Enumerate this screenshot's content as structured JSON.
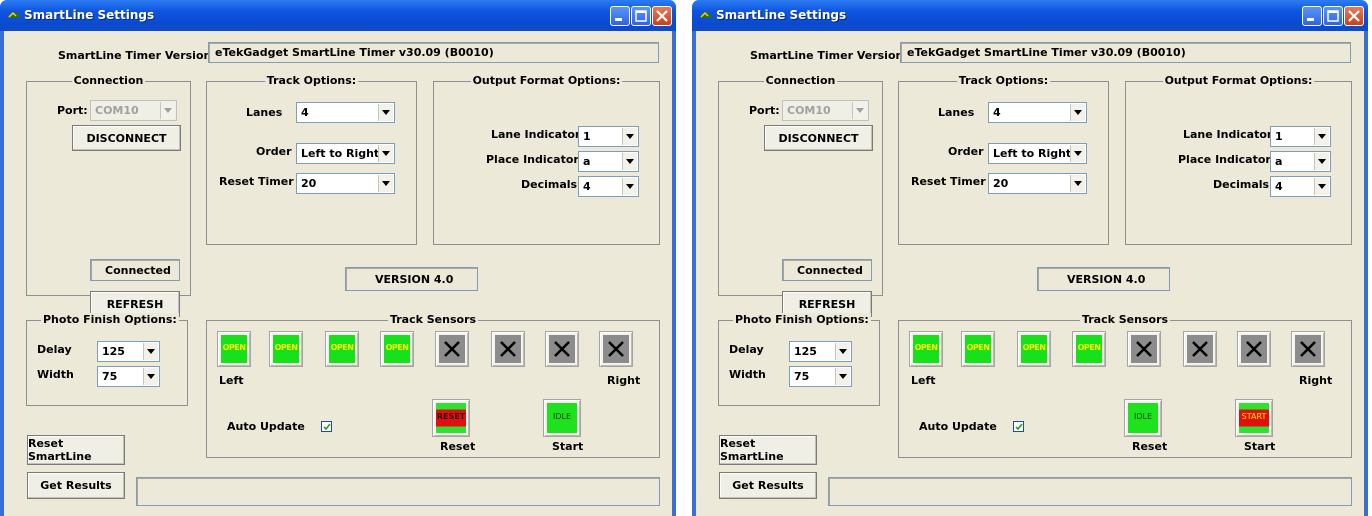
{
  "title": "SmartLine Settings",
  "version_label": "SmartLine Timer Version:",
  "version_value": "eTekGadget SmartLine Timer v30.09 (B0010)",
  "connection": {
    "legend": "Connection",
    "port_label": "Port:",
    "port_value": "COM10",
    "disconnect": "DISCONNECT",
    "status": "Connected",
    "refresh": "REFRESH"
  },
  "track_options": {
    "legend": "Track Options:",
    "lanes_label": "Lanes",
    "lanes_value": "4",
    "order_label": "Order",
    "order_value": "Left to Right",
    "reset_label": "Reset Timer",
    "reset_value": "20"
  },
  "output_options": {
    "legend": "Output Format Options:",
    "lane_indicator_label": "Lane Indicator",
    "lane_indicator_value": "1",
    "place_indicator_label": "Place Indicator",
    "place_indicator_value": "a",
    "decimals_label": "Decimals",
    "decimals_value": "4"
  },
  "app_version": "VERSION 4.0",
  "photo_finish": {
    "legend": "Photo Finish Options:",
    "delay_label": "Delay",
    "delay_value": "125",
    "width_label": "Width",
    "width_value": "75"
  },
  "track_sensors": {
    "legend": "Track Sensors",
    "open_text": "OPEN",
    "left_label": "Left",
    "right_label": "Right",
    "auto_update_label": "Auto Update",
    "reset_label": "Reset",
    "start_label": "Start"
  },
  "windows": [
    {
      "reset_button_text": "RESET",
      "start_button_text": "IDLE"
    },
    {
      "reset_button_text": "IDLE",
      "start_button_text": "START"
    }
  ],
  "reset_smartline": "Reset SmartLine",
  "get_results": "Get Results",
  "icons": [
    "app-icon",
    "minimize-icon",
    "maximize-icon",
    "close-icon",
    "dropdown-arrow-icon",
    "x-icon",
    "check-icon"
  ]
}
